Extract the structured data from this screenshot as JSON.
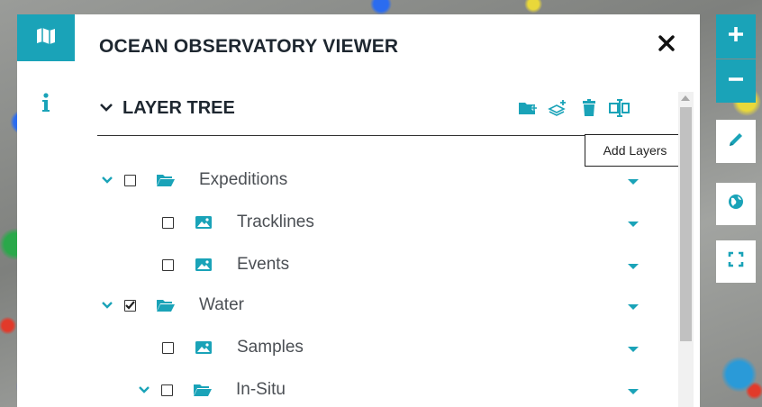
{
  "panel": {
    "title": "OCEAN OBSERVATORY VIEWER"
  },
  "rail": {
    "items": [
      {
        "icon": "map-icon"
      },
      {
        "icon": "info-icon"
      }
    ]
  },
  "layer_tree": {
    "title": "LAYER TREE",
    "toolbar": [
      {
        "icon": "add-folder-icon"
      },
      {
        "icon": "add-layers-icon"
      },
      {
        "icon": "trash-icon"
      },
      {
        "icon": "rename-icon"
      }
    ],
    "tooltip": "Add Layers",
    "rows": [
      {
        "label": "Expeditions",
        "type": "folder",
        "checked": false,
        "expanded": true
      },
      {
        "label": "Tracklines",
        "type": "layer",
        "checked": false
      },
      {
        "label": "Events",
        "type": "layer",
        "checked": false
      },
      {
        "label": "Water",
        "type": "folder",
        "checked": true,
        "expanded": true
      },
      {
        "label": "Samples",
        "type": "layer",
        "checked": false
      },
      {
        "label": "In-Situ",
        "type": "folder",
        "checked": false,
        "expanded": true
      }
    ]
  },
  "map_controls": [
    {
      "icon": "zoom-in-icon"
    },
    {
      "icon": "zoom-out-icon"
    },
    {
      "icon": "pencil-icon"
    },
    {
      "icon": "globe-icon"
    },
    {
      "icon": "fullscreen-icon"
    }
  ],
  "colors": {
    "accent": "#1aa3b8",
    "text": "#1e2730"
  }
}
